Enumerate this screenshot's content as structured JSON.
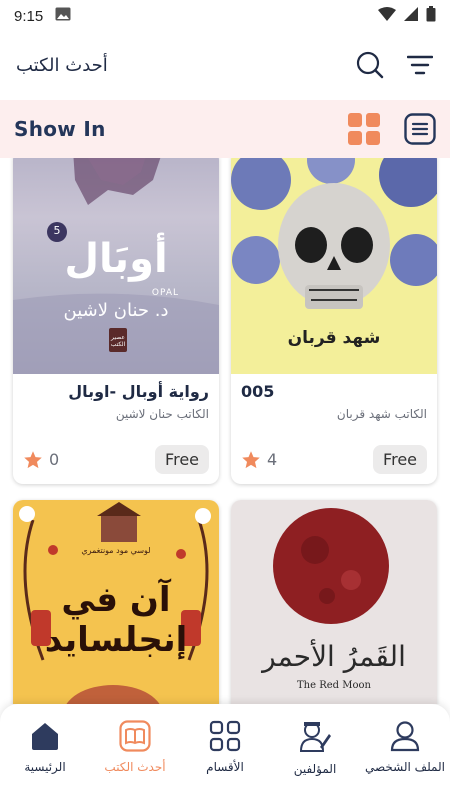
{
  "status": {
    "time": "9:15"
  },
  "header": {
    "title": "أحدث الكتب"
  },
  "show_bar": {
    "label": "Show In"
  },
  "books": [
    {
      "title": "رواية أوبال -اوبال",
      "author": "الكاتب حنان لاشين",
      "rating": "0",
      "price": "Free",
      "cover_title": "أوبَال",
      "cover_subtitle": "OPAL",
      "cover_author": "د. حنان لاشين",
      "cover_badge": "5",
      "cover_publisher": "عصير الكتب"
    },
    {
      "title": "005",
      "author": "الكاتب شهد قربان",
      "rating": "4",
      "price": "Free",
      "cover_author": "شهد قربان"
    },
    {
      "title": "",
      "author": "",
      "cover_title": "آن في إنجلسايد",
      "cover_author": "لوسي مود مونتغمري"
    },
    {
      "title": "",
      "author": "",
      "cover_title": "القَمرُ الأحمر",
      "cover_subtitle": "The Red Moon"
    }
  ],
  "nav": [
    {
      "label": "الملف الشخصي",
      "icon": "person-icon"
    },
    {
      "label": "المؤلفين",
      "icon": "author-icon"
    },
    {
      "label": "الأقسام",
      "icon": "grid-icon"
    },
    {
      "label": "أحدث الكتب",
      "icon": "book-icon",
      "active": true
    },
    {
      "label": "الرئيسية",
      "icon": "home-icon"
    }
  ],
  "colors": {
    "accent": "#f08a5d",
    "primary": "#24365a",
    "show_bar_bg": "#fdeeee",
    "star": "#f08a5d"
  }
}
